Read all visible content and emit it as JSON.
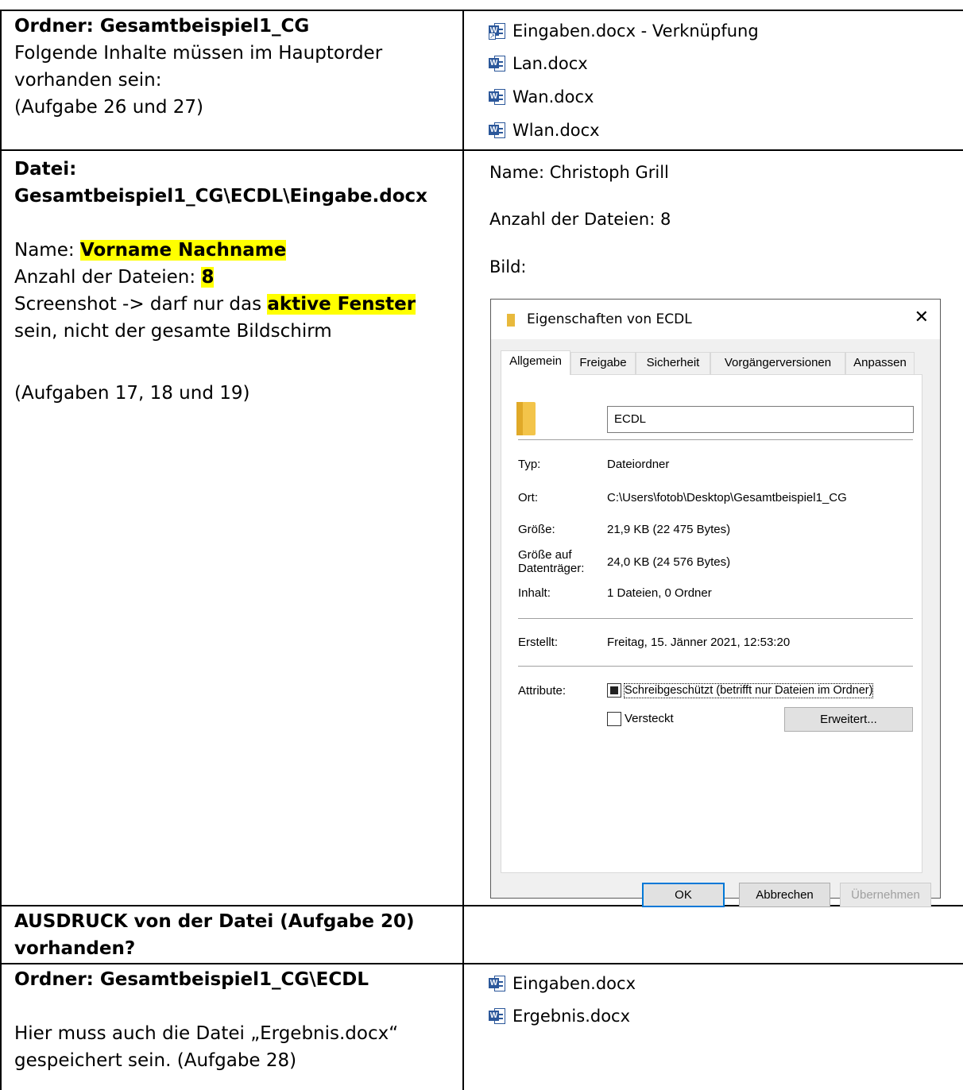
{
  "row1": {
    "left_title": "Ordner: Gesamtbeispiel1_CG",
    "left_lines": [
      "Folgende Inhalte müssen im Hauptorder",
      "vorhanden sein:",
      "(Aufgabe 26 und 27)"
    ],
    "files": [
      "Eingaben.docx - Verknüpfung",
      "Lan.docx",
      "Wan.docx",
      "Wlan.docx"
    ]
  },
  "row2": {
    "left_title_1": "Datei:",
    "left_title_2": "Gesamtbeispiel1_CG\\ECDL\\Eingabe.docx",
    "name_label": "Name: ",
    "name_value": "Vorname Nachname",
    "count_label": "Anzahl der Dateien: ",
    "count_value": "8",
    "screenshot_pre": "Screenshot -> darf nur das ",
    "screenshot_hl": "aktive Fenster",
    "screenshot_post": "sein, nicht der gesamte Bildschirm",
    "tasks": "(Aufgaben 17, 18 und 19)",
    "right_name": "Name: Christoph Grill",
    "right_count": "Anzahl der Dateien: 8",
    "right_bild": "Bild:"
  },
  "dialog": {
    "title": "Eigenschaften von ECDL",
    "close": "✕",
    "tabs": [
      "Allgemein",
      "Freigabe",
      "Sicherheit",
      "Vorgängerversionen",
      "Anpassen"
    ],
    "name_value": "ECDL",
    "typ_label": "Typ:",
    "typ_value": "Dateiordner",
    "ort_label": "Ort:",
    "ort_value": "C:\\Users\\fotob\\Desktop\\Gesamtbeispiel1_CG",
    "groesse_label": "Größe:",
    "groesse_value": "21,9 KB (22 475 Bytes)",
    "groesse_auf_label_1": "Größe auf",
    "groesse_auf_label_2": "Datenträger:",
    "groesse_auf_value": "24,0 KB (24 576 Bytes)",
    "inhalt_label": "Inhalt:",
    "inhalt_value": "1 Dateien, 0 Ordner",
    "erstellt_label": "Erstellt:",
    "erstellt_value": "Freitag, 15. Jänner 2021, 12:53:20",
    "attribute_label": "Attribute:",
    "readonly_label": "Schreibgeschützt (betrifft nur Dateien im Ordner)",
    "hidden_label": "Versteckt",
    "advanced_label": "Erweitert...",
    "ok_label": "OK",
    "cancel_label": "Abbrechen",
    "apply_label": "Übernehmen"
  },
  "row3": {
    "left_line1": "AUSDRUCK von der Datei (Aufgabe 20)",
    "left_line2": "vorhanden?"
  },
  "row4": {
    "left_title": "Ordner: Gesamtbeispiel1_CG\\ECDL",
    "left_line1": "Hier muss auch die Datei „Ergebnis.docx“",
    "left_line2": "gespeichert sein. (Aufgabe 28)",
    "files": [
      "Eingaben.docx",
      "Ergebnis.docx"
    ]
  }
}
